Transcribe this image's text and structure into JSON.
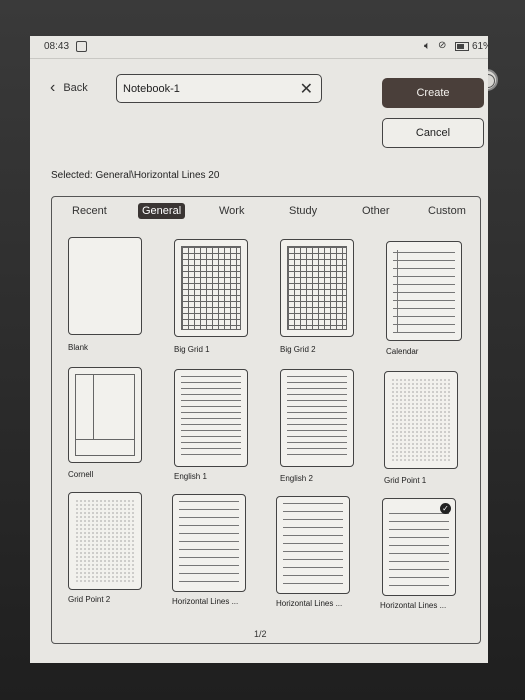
{
  "status": {
    "time": "08:43",
    "battery": "61%"
  },
  "header": {
    "back_label": "Back",
    "name_value": "Notebook-1",
    "create_label": "Create",
    "cancel_label": "Cancel"
  },
  "selected_text": "Selected: General\\Horizontal Lines 20",
  "tabs": [
    "Recent",
    "General",
    "Work",
    "Study",
    "Other",
    "Custom"
  ],
  "active_tab": "General",
  "templates": [
    {
      "label": "Blank",
      "style": "blank"
    },
    {
      "label": "Big Grid 1",
      "style": "grid"
    },
    {
      "label": "Big Grid 2",
      "style": "grid"
    },
    {
      "label": "Calendar",
      "style": "calendar"
    },
    {
      "label": "Cornell",
      "style": "cornell"
    },
    {
      "label": "English 1",
      "style": "english"
    },
    {
      "label": "English 2",
      "style": "english"
    },
    {
      "label": "Grid Point 1",
      "style": "dots"
    },
    {
      "label": "Grid Point 2",
      "style": "dots"
    },
    {
      "label": "Horizontal Lines ...",
      "style": "lines"
    },
    {
      "label": "Horizontal Lines ...",
      "style": "lines"
    },
    {
      "label": "Horizontal Lines ...",
      "style": "lines",
      "selected": true
    }
  ],
  "page_indicator": "1/2"
}
